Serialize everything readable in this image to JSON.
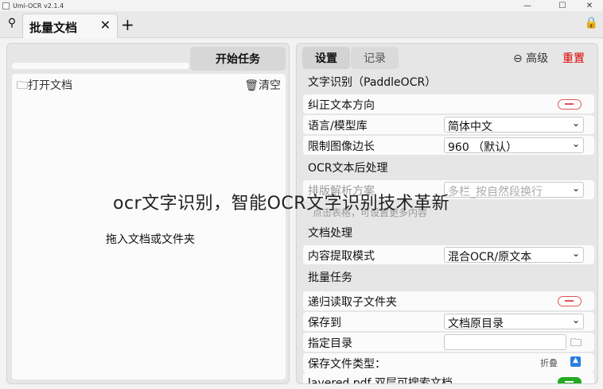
{
  "window": {
    "title": "Umi-OCR v2.1.4",
    "minimize": "—",
    "maximize": "☐",
    "close": "✕"
  },
  "tabbar": {
    "pin_icon": "⚲",
    "tab_label": "批量文档",
    "close_icon": "✕",
    "add_icon": "+",
    "lock_icon": "🔒"
  },
  "left": {
    "start_button": "开始任务",
    "open_button": "🗀打开文档",
    "clear_button": "🗑清空",
    "drop_tip": "拖入文档或文件夹"
  },
  "right": {
    "tabs": [
      {
        "label": "设置"
      },
      {
        "label": "记录"
      }
    ],
    "advanced": "⊖ 高级",
    "reset": "重置",
    "section_ocr": "文字识别（PaddleOCR）",
    "row_correct_direction": "纠正文本方向",
    "row_language": "语言/模型库",
    "language_value": "简体中文",
    "row_limit_size": "限制图像边长",
    "limit_size_value": "960 （默认）",
    "section_post": "OCR文本后处理",
    "row_layout": "排版解析方案",
    "layout_value": "多栏_按自然段换行",
    "layout_hint": "点击表格，可设置更多内容",
    "section_doc": "文档处理",
    "row_extract_mode": "内容提取模式",
    "extract_mode_value": "混合OCR/原文本",
    "section_batch": "批量任务",
    "row_recursive": "递归读取子文件夹",
    "row_save_to": "保存到",
    "save_to_value": "文档原目录",
    "row_target_dir": "指定目录",
    "target_dir_value": "",
    "row_file_types": "保存文件类型：",
    "fold_label": "折叠",
    "row_layered_pdf": "layered.pdf 双层可搜索文档"
  },
  "overlay": {
    "watermark": "ocr文字识别，智能OCR文字识别技术革新"
  }
}
